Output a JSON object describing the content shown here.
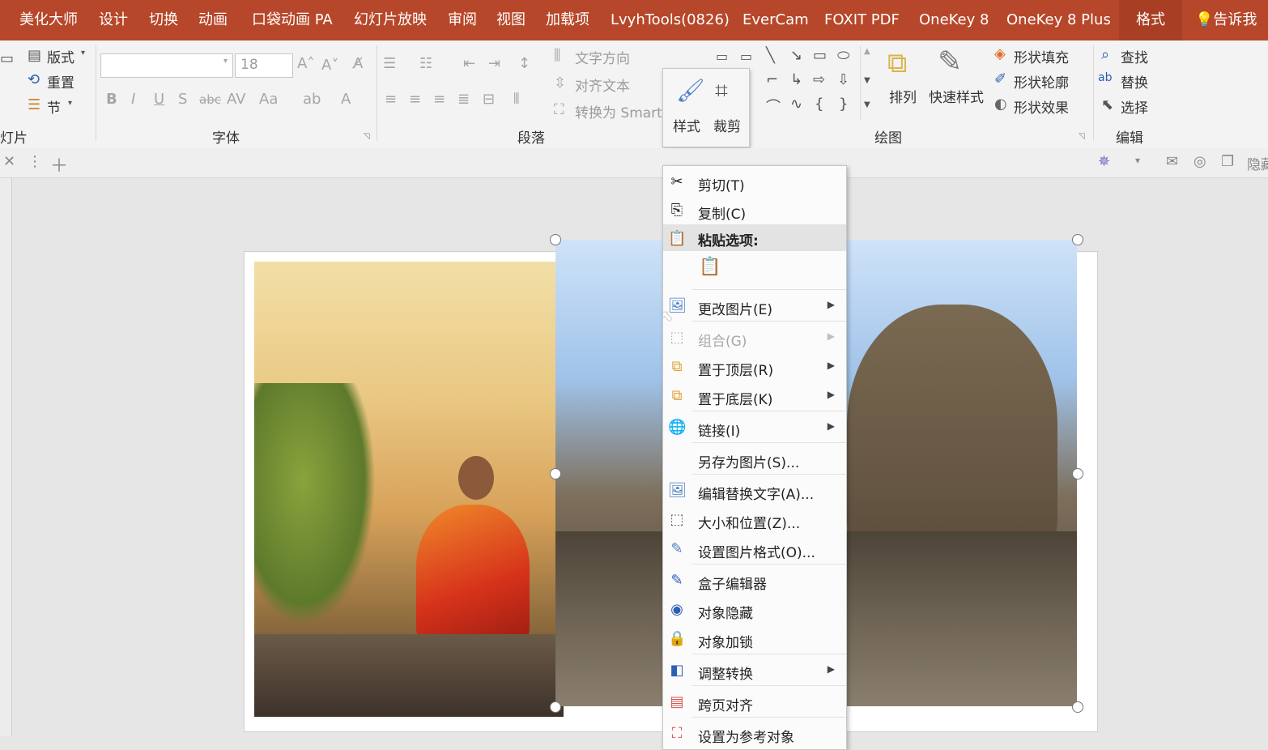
{
  "tabs": [
    "美化大师",
    "设计",
    "切换",
    "动画",
    "口袋动画 PA",
    "幻灯片放映",
    "审阅",
    "视图",
    "加载项",
    "LvyhTools(0826)",
    "EverCam",
    "FOXIT PDF",
    "OneKey 8",
    "OneKey 8 Plus",
    "格式"
  ],
  "tell_me": "告诉我",
  "ribbon": {
    "slides_group": {
      "layout": "版式",
      "reset": "重置",
      "section": "节",
      "label": "灯片"
    },
    "font_group": {
      "font_size": "18",
      "label": "字体"
    },
    "paragraph_group": {
      "text_direction": "文字方向",
      "align_text": "对齐文本",
      "convert_smartart": "转换为 SmartArt",
      "label": "段落"
    },
    "style_popup": {
      "style": "样式",
      "crop": "裁剪"
    },
    "drawing_group": {
      "arrange": "排列",
      "quick_styles": "快速样式",
      "shape_fill": "形状填充",
      "shape_outline": "形状轮廓",
      "shape_effects": "形状效果",
      "label": "绘图"
    },
    "editing_group": {
      "find": "查找",
      "replace": "替换",
      "select": "选择",
      "label": "编辑"
    }
  },
  "qbar": {
    "right_label": "隐藏"
  },
  "context_menu": {
    "cut": "剪切(T)",
    "copy": "复制(C)",
    "paste_options": "粘贴选项:",
    "change_picture": "更改图片(E)",
    "group": "组合(G)",
    "bring_front": "置于顶层(R)",
    "send_back": "置于底层(K)",
    "link": "链接(I)",
    "save_as_picture": "另存为图片(S)...",
    "edit_alt_text": "编辑替换文字(A)...",
    "size_position": "大小和位置(Z)...",
    "format_picture": "设置图片格式(O)...",
    "box_editor": "盒子编辑器",
    "object_hide": "对象隐藏",
    "object_lock": "对象加锁",
    "adjust_convert": "调整转换",
    "cross_page_align": "跨页对齐",
    "set_reference": "设置为参考对象"
  },
  "colors": {
    "accent": "#b7472a",
    "ribbon": "#f3f3f3",
    "menu_hover": "#e3e3e3"
  }
}
